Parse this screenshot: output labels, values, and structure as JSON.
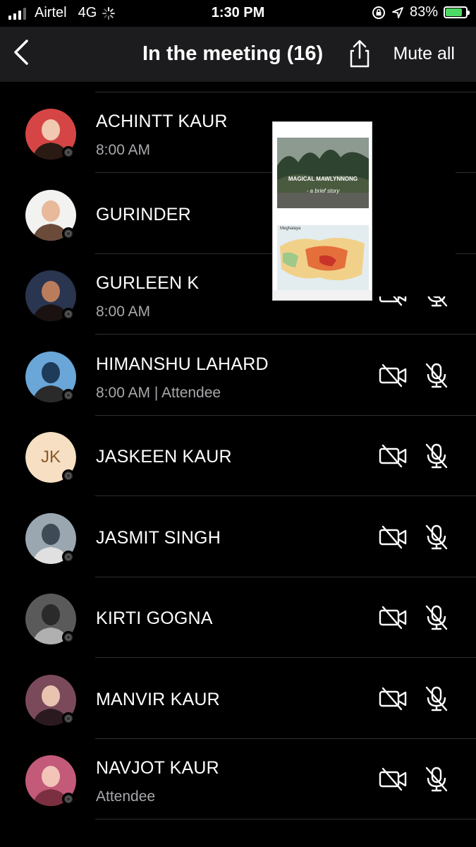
{
  "status_bar": {
    "carrier": "Airtel",
    "network": "4G",
    "time": "1:30 PM",
    "battery": "83%",
    "battery_level": 0.83
  },
  "header": {
    "title": "In the meeting (16)",
    "mute_all_label": "Mute all"
  },
  "participants": [
    {
      "name": "ACHINTT KAUR",
      "sub": "8:00 AM",
      "avatar": "photo-girl-red"
    },
    {
      "name": "GURINDER",
      "sub": "",
      "avatar": "photo-boy-white"
    },
    {
      "name": "GURLEEN K",
      "sub": "8:00 AM",
      "avatar": "photo-girl-smile"
    },
    {
      "name": "HIMANSHU LAHARD",
      "sub": "8:00 AM | Attendee",
      "avatar": "photo-bicycle"
    },
    {
      "name": "JASKEEN KAUR",
      "sub": "",
      "initials": "JK"
    },
    {
      "name": "JASMIT SINGH",
      "sub": "",
      "avatar": "photo-truck"
    },
    {
      "name": "KIRTI GOGNA",
      "sub": "",
      "avatar": "photo-grayscale"
    },
    {
      "name": "MANVIR KAUR",
      "sub": "",
      "avatar": "photo-girl-pink"
    },
    {
      "name": "NAVJOT KAUR",
      "sub": "Attendee",
      "avatar": "photo-baby"
    }
  ],
  "shared_screen_preview": {
    "title": "MAGICAL MAWLYNNONG",
    "subtitle": "- a brief story",
    "map_label": "Meghalaya"
  },
  "icons": {
    "back": "chevron-left-icon",
    "share": "share-upload-icon",
    "camera_off": "video-off-icon",
    "mic_off": "mic-off-icon"
  },
  "colors": {
    "background": "#000000",
    "navbar": "#1c1c1e",
    "secondary_text": "#a8a8ad",
    "battery": "#4cd964"
  }
}
